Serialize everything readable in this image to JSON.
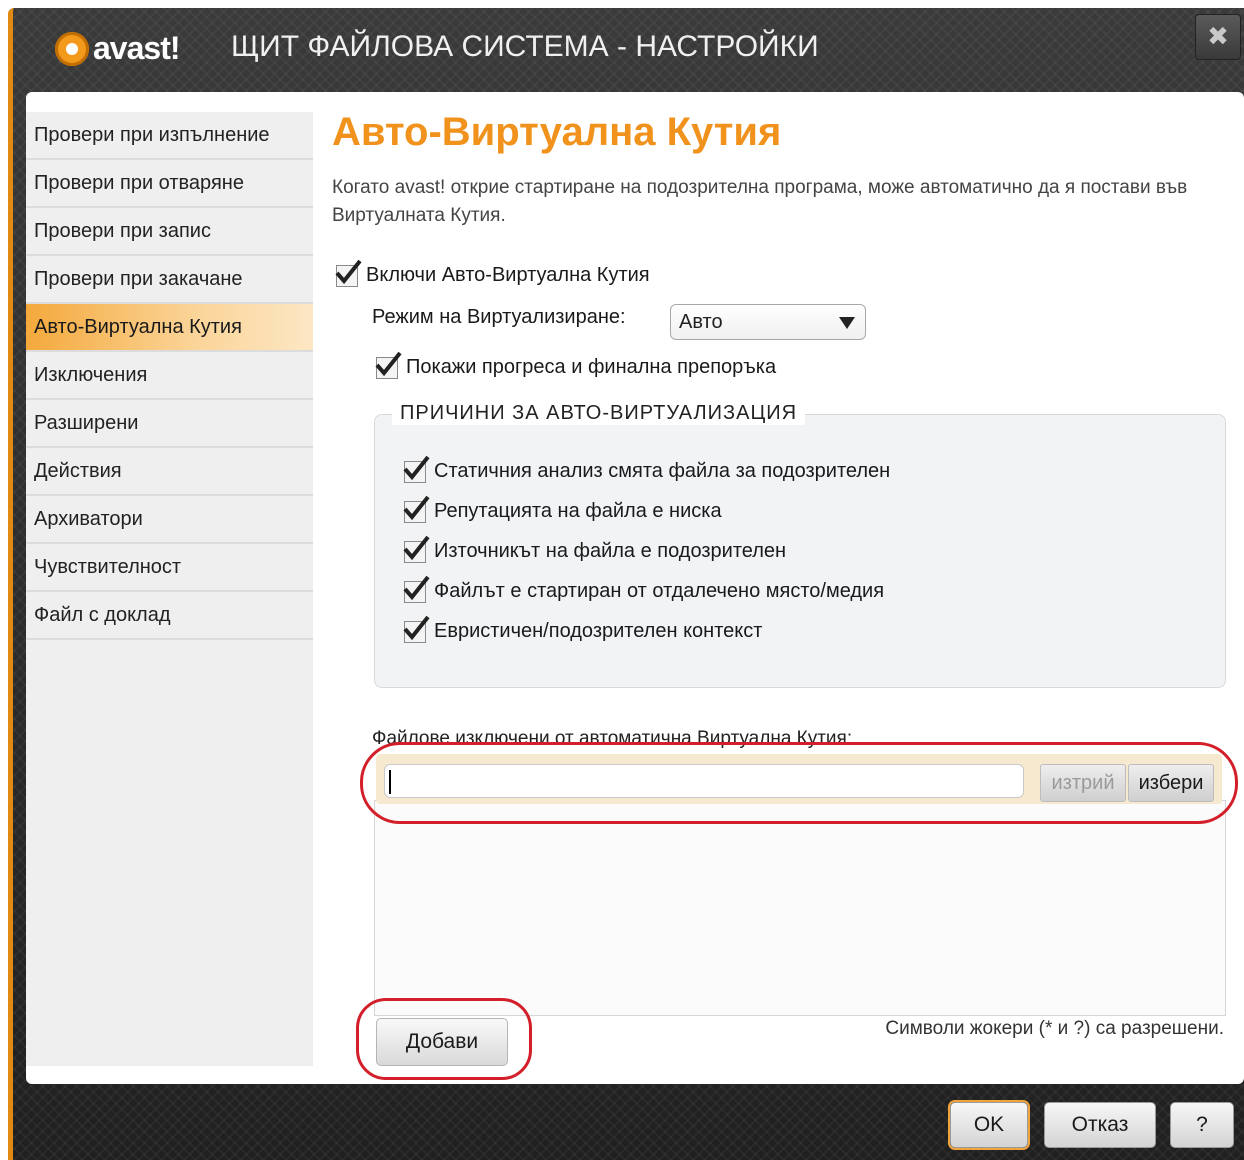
{
  "window": {
    "brand": "avast!",
    "title": "ЩИТ ФАЙЛОВА СИСТЕМА - НАСТРОЙКИ",
    "close_glyph": "✖"
  },
  "sidebar": {
    "items": [
      {
        "label": "Провери при изпълнение"
      },
      {
        "label": "Провери при отваряне"
      },
      {
        "label": "Провери при запис"
      },
      {
        "label": "Провери при закачане"
      },
      {
        "label": "Авто-Виртуална Кутия"
      },
      {
        "label": "Изключения"
      },
      {
        "label": "Разширени"
      },
      {
        "label": "Действия"
      },
      {
        "label": "Архиватори"
      },
      {
        "label": "Чувствителност"
      },
      {
        "label": "Файл с доклад"
      }
    ],
    "active_index": 4
  },
  "main": {
    "title": "Авто-Виртуална Кутия",
    "description": "Когато avast! открие стартиране на подозрителна програма, може автоматично да я постави във Виртуалната Кутия.",
    "enable_label": "Включи Авто-Виртуална Кутия",
    "enable_checked": true,
    "mode_label": "Режим на Виртуализиране:",
    "mode_value": "Авто",
    "progress_label": "Покажи прогреса и финална препоръка",
    "progress_checked": true,
    "reasons": {
      "legend": "ПРИЧИНИ ЗА АВТО-ВИРТУАЛИЗАЦИЯ",
      "items": [
        {
          "label": "Статичния анализ смята файла за подозрителен",
          "checked": true
        },
        {
          "label": "Репутацията на файла е ниска",
          "checked": true
        },
        {
          "label": "Източникът на файла е подозрителен",
          "checked": true
        },
        {
          "label": "Файлът е стартиран от отдалечено място/медия",
          "checked": true
        },
        {
          "label": "Евристичен/подозрителен контекст",
          "checked": true
        }
      ]
    },
    "exclusions": {
      "label": "Файлове изключени от автоматична Виртуална Кутия:",
      "input_value": "",
      "clear_label": "изтрий",
      "choose_label": "избери",
      "add_label": "Добави",
      "wildcard_note": "Символи жокери (* и ?) са разрешени."
    }
  },
  "footer": {
    "ok_label": "OK",
    "cancel_label": "Отказ",
    "help_label": "?"
  },
  "colors": {
    "accent": "#f0921c",
    "frame_dark": "#2b2b2b",
    "highlight_red": "#d21f2a"
  }
}
